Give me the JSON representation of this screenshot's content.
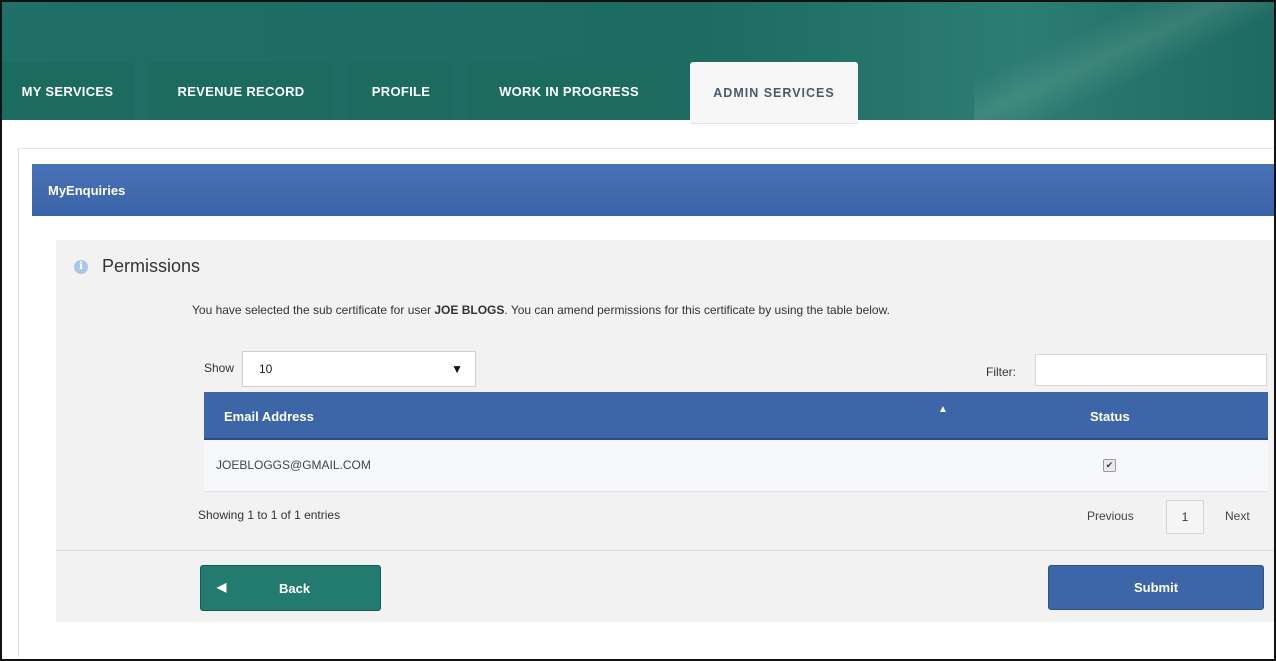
{
  "nav": {
    "tabs": [
      {
        "label": "MY SERVICES",
        "active": false
      },
      {
        "label": "REVENUE RECORD",
        "active": false
      },
      {
        "label": "PROFILE",
        "active": false
      },
      {
        "label": "WORK IN PROGRESS",
        "active": false
      },
      {
        "label": "ADMIN SERVICES",
        "active": true
      }
    ]
  },
  "section": {
    "title": "MyEnquiries"
  },
  "permissions": {
    "title": "Permissions",
    "desc_before": "You have selected the sub certificate for user ",
    "user": "JOE BLOGS",
    "desc_after": ". You can amend permissions for this certificate by using the table below."
  },
  "table": {
    "show_label": "Show",
    "show_value": "10",
    "filter_label": "Filter:",
    "filter_value": "",
    "headers": {
      "email": "Email Address",
      "status": "Status"
    },
    "rows": [
      {
        "email": "JOEBLOGGS@GMAIL.COM",
        "status_checked": true
      }
    ],
    "info": "Showing 1 to 1 of 1 entries",
    "pagination": {
      "previous": "Previous",
      "page": "1",
      "next": "Next"
    }
  },
  "buttons": {
    "back": "Back",
    "submit": "Submit"
  },
  "icons": {
    "info": "info-icon",
    "sort": "sort-asc-icon",
    "back": "left-triangle-icon",
    "dropdown": "dropdown-arrow-icon",
    "checkbox": "checkbox-checked-icon"
  },
  "colors": {
    "nav_green": "#1f6f66",
    "tab_green": "#1b6b5e",
    "header_blue": "#3d66a8",
    "back_green": "#237a6f"
  }
}
